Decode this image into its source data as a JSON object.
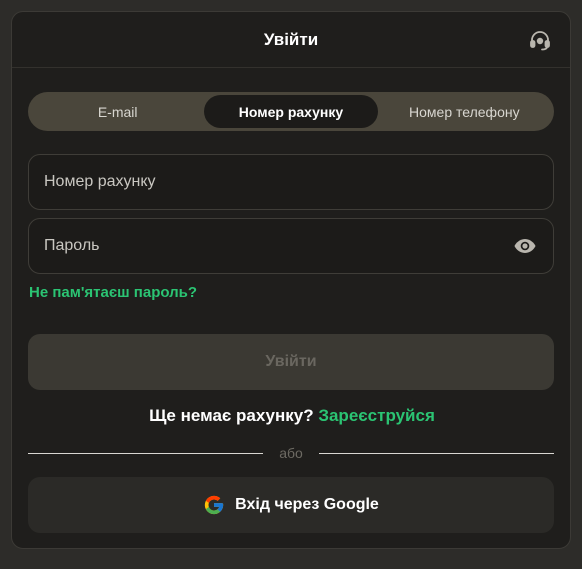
{
  "modal": {
    "title": "Увійти",
    "support_icon": "headset-icon"
  },
  "tabs": [
    {
      "label": "E-mail",
      "active": false
    },
    {
      "label": "Номер рахунку",
      "active": true
    },
    {
      "label": "Номер телефону",
      "active": false
    }
  ],
  "form": {
    "account_placeholder": "Номер рахунку",
    "account_value": "",
    "password_placeholder": "Пароль",
    "password_value": "",
    "password_toggle_icon": "eye-icon",
    "forgot_label": "Не пам'ятаєш пароль?",
    "submit_label": "Увійти"
  },
  "register": {
    "question": "Ще немає рахунку?",
    "link_label": "Зареєструйся"
  },
  "divider": {
    "label": "або"
  },
  "google": {
    "label": "Вхід через Google",
    "icon": "google-icon"
  },
  "colors": {
    "accent": "#2bc473",
    "background": "#1f1e1c",
    "tab_track": "#4a463b"
  }
}
